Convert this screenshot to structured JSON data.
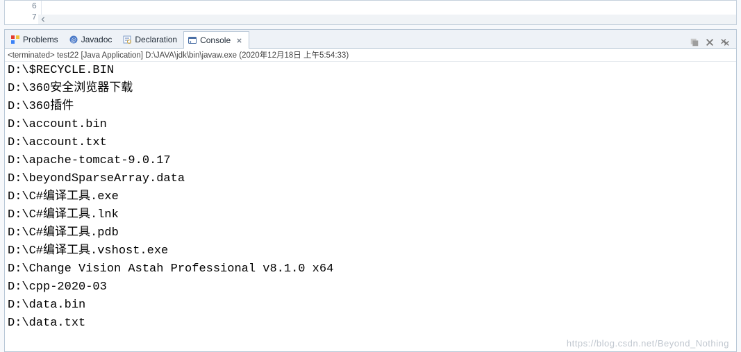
{
  "editor": {
    "line_numbers": [
      "6",
      "7"
    ]
  },
  "tabs": [
    {
      "label": "Problems",
      "icon": "problems-icon"
    },
    {
      "label": "Javadoc",
      "icon": "javadoc-icon"
    },
    {
      "label": "Declaration",
      "icon": "declaration-icon"
    },
    {
      "label": "Console",
      "icon": "console-icon"
    }
  ],
  "active_tab_index": 3,
  "console": {
    "header": "<terminated> test22 [Java Application] D:\\JAVA\\jdk\\bin\\javaw.exe (2020年12月18日 上午5:54:33)",
    "lines": [
      "D:\\$RECYCLE.BIN",
      "D:\\360安全浏览器下载",
      "D:\\360插件",
      "D:\\account.bin",
      "D:\\account.txt",
      "D:\\apache-tomcat-9.0.17",
      "D:\\beyondSparseArray.data",
      "D:\\C#编译工具.exe",
      "D:\\C#编译工具.lnk",
      "D:\\C#编译工具.pdb",
      "D:\\C#编译工具.vshost.exe",
      "D:\\Change Vision Astah Professional v8.1.0 x64",
      "D:\\cpp-2020-03",
      "D:\\data.bin",
      "D:\\data.txt"
    ]
  },
  "watermark": "https://blog.csdn.net/Beyond_Nothing"
}
